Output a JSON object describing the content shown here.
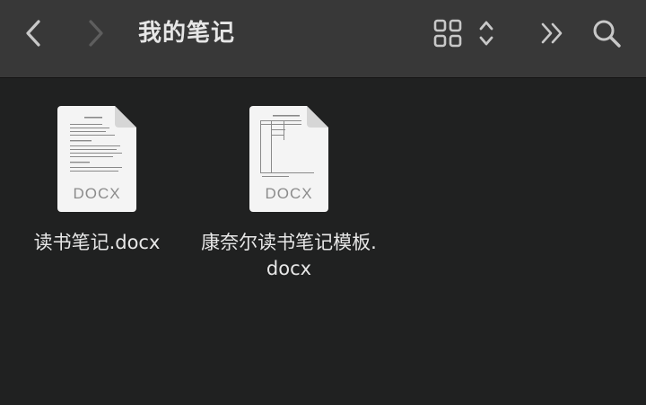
{
  "toolbar": {
    "title": "我的笔记",
    "back_icon": "chevron-left-icon",
    "forward_icon": "chevron-right-icon",
    "view_icon": "grid-view-icon",
    "more_icon": "double-chevron-right-icon",
    "search_icon": "search-icon"
  },
  "files": [
    {
      "name": "读书笔记.docx",
      "ext": "DOCX"
    },
    {
      "name": "康奈尔读书笔记模板.docx",
      "ext": "DOCX"
    }
  ],
  "colors": {
    "toolbar_bg": "#383838",
    "content_bg": "#202121",
    "text": "#e8e8e8",
    "icon_enabled": "#c8c8c8",
    "icon_disabled": "#6a6a6a"
  }
}
